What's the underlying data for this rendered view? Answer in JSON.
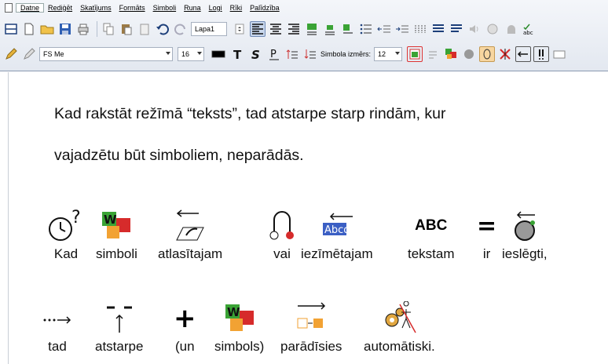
{
  "menu": [
    "Datne",
    "Rediģēt",
    "Skatījums",
    "Formāts",
    "Simboli",
    "Runa",
    "Logi",
    "Rīki",
    "Palīdzība"
  ],
  "toolbar1": {
    "page_name": "Lapa1"
  },
  "toolbar2": {
    "font": "FS Me",
    "font_size": "16",
    "symbol_size_label": "Simbola izmērs:",
    "symbol_size": "12"
  },
  "document": {
    "line1": "Kad rakstāt režīmā “teksts”, tad atstarpe starp rindām, kur",
    "line2": "vajadzētu būt simboliem, neparādās.",
    "row1": [
      "Kad",
      "simboli",
      "atlasītajam",
      "vai",
      "iezīmētajam",
      "tekstam",
      "ir",
      "ieslēgti,"
    ],
    "row2": [
      "tad",
      "atstarpe",
      "(un",
      "simbols)",
      "parādīsies",
      "automātiski."
    ],
    "abc_symbol": "ABC",
    "abcd_symbol": "Abcd",
    "equals_symbol": "=",
    "plus_symbol": "+",
    "w_letter": "W"
  },
  "colors": {
    "chrome": "#e3e8f0",
    "green": "#3aa335",
    "red": "#d62b2b",
    "orange": "#f2a233",
    "blue": "#3b5fc4"
  }
}
